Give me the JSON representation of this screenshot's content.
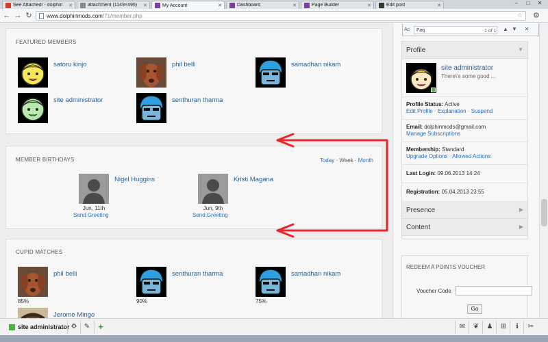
{
  "browser": {
    "tabs": [
      {
        "label": "See Attached! - dolphin",
        "favicon_color": "#d33b2c"
      },
      {
        "label": "attachment (1149×495)",
        "favicon_color": "#8a8a8a"
      },
      {
        "label": "My Account",
        "favicon_color": "#7a3f9c",
        "active": true
      },
      {
        "label": "Dashboard",
        "favicon_color": "#7a3f9c"
      },
      {
        "label": "Page Builder",
        "favicon_color": "#7a3f9c"
      },
      {
        "label": "Edit post",
        "favicon_color": "#2c3e2c"
      }
    ],
    "url_host": "www.dolphinmods.com",
    "url_path": "/71/member.php"
  },
  "findbar": {
    "prefix": "Ac",
    "query": "Faq",
    "count": "1 of 1"
  },
  "featured": {
    "title": "FEATURED MEMBERS",
    "members": [
      {
        "name": "satoru kinjo",
        "avatar": "yellow-girl"
      },
      {
        "name": "phil belli",
        "avatar": "dog"
      },
      {
        "name": "samadhan nikam",
        "avatar": "blue-man"
      },
      {
        "name": "site administrator",
        "avatar": "green-girl"
      },
      {
        "name": "senthuran tharma",
        "avatar": "blue-man"
      }
    ]
  },
  "birthdays": {
    "title": "MEMBER BIRTHDAYS",
    "links": {
      "today": "Today",
      "week": "Week",
      "month": "Month"
    },
    "members": [
      {
        "name": "Nigel Huggins",
        "date": "Jun, 11th",
        "greet": "Send Greeting"
      },
      {
        "name": "Kristi Magana",
        "date": "Jun, 9th",
        "greet": "Send Greeting"
      }
    ]
  },
  "cupid": {
    "title": "CUPID MATCHES",
    "members": [
      {
        "name": "phil belli",
        "pct": "85%",
        "avatar": "dog"
      },
      {
        "name": "senthuran tharma",
        "pct": "90%",
        "avatar": "blue-man"
      },
      {
        "name": "samadhan nikam",
        "pct": "75%",
        "avatar": "blue-man"
      },
      {
        "name": "Jerome Mingo",
        "pct": "",
        "avatar": "photo"
      }
    ]
  },
  "profile": {
    "header": "Profile",
    "name": "site administrator",
    "status_msg": "There\\'s some good ...",
    "status_label": "Profile Status:",
    "status_value": "Active",
    "status_links": [
      "Edit Profile",
      "Explanation",
      "Suspend"
    ],
    "email_label": "Email:",
    "email_value": "dolphinmods@gmail.com",
    "email_link": "Manage Subscriptions",
    "membership_label": "Membership:",
    "membership_value": "Standard",
    "membership_links": [
      "Upgrade Options",
      "Allowed Actions"
    ],
    "last_login_label": "Last Login:",
    "last_login_value": "09.06.2013 14:24",
    "registration_label": "Registration:",
    "registration_value": "05.04.2013 23:55",
    "presence": "Presence",
    "content": "Content"
  },
  "voucher": {
    "title": "REDEEM A POINTS VOUCHER",
    "label": "Voucher Code",
    "button": "Go"
  },
  "bottombar": {
    "username": "site administrator"
  },
  "colors": {
    "link": "#2a6fb6",
    "arrow": "#e8262b",
    "online": "#4bb33a"
  }
}
